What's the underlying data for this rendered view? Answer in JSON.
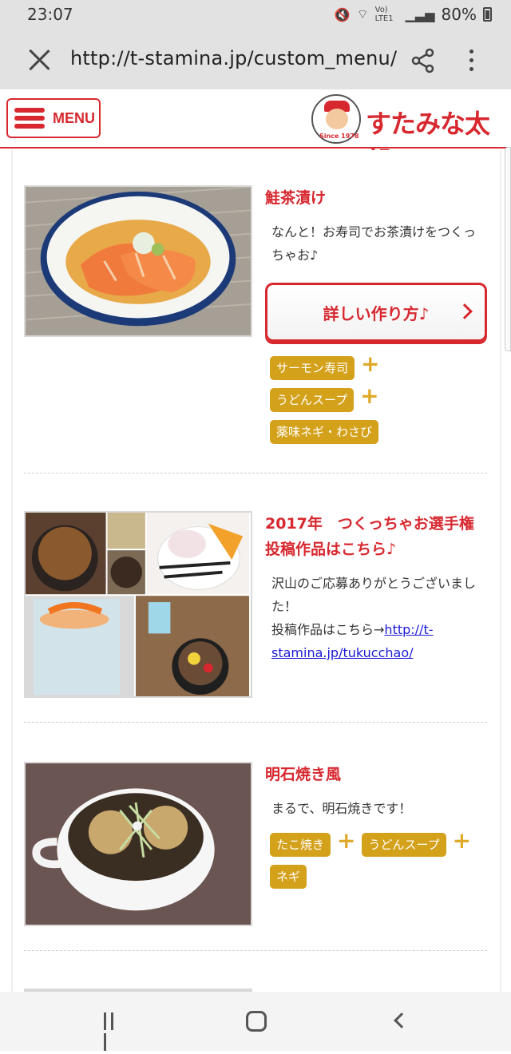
{
  "status_bar": {
    "time": "23:07",
    "network_label": "Vo) LTE1",
    "battery": "80%"
  },
  "browser": {
    "url": "http://t-stamina.jp/custom_menu/"
  },
  "header": {
    "menu_label": "MENU",
    "logo_text": "すたみな太郎",
    "logo_since": "Since 1978"
  },
  "entries": [
    {
      "title": "鮭茶漬け",
      "description": "なんと！お寿司でお茶漬けをつくっちゃお♪",
      "howto_label": "詳しい作り方♪",
      "tag_rows": [
        [
          "サーモン寿司"
        ],
        [
          "うどんスープ"
        ],
        [
          "薬味ネギ・わさび"
        ]
      ]
    },
    {
      "title": "2017年　つくっちゃお選手権　投稿作品はこちら♪",
      "description": "沢山のご応募ありがとうございました！",
      "link_prefix": "投稿作品はこちら→",
      "link_text": "http://t-stamina.jp/tukucchao/"
    },
    {
      "title": "明石焼き風",
      "description": "まるで、明石焼きです！",
      "tag_rows": [
        [
          "たこ焼き",
          "うどんスープ"
        ],
        [
          "ネギ"
        ]
      ]
    }
  ],
  "tag_color": "#d4a11b",
  "accent_color": "#d7282f"
}
